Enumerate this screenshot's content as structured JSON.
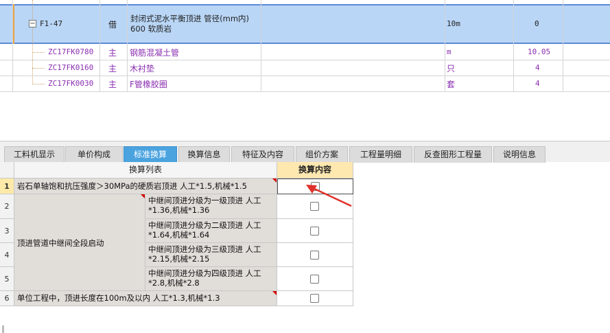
{
  "top_table": {
    "rows": [
      {
        "code": "F1-47",
        "category": "借",
        "name_line1": "封闭式泥水平衡顶进 管径(mm内)",
        "name_line2": "600 软质岩",
        "unit": "10m",
        "quantity": "0",
        "selected": true
      },
      {
        "code": "ZC17FK0780",
        "category": "主",
        "name": "钢筋混凝土管",
        "unit": "m",
        "quantity": "10.05"
      },
      {
        "code": "ZC17FK0160",
        "category": "主",
        "name": "木衬垫",
        "unit": "只",
        "quantity": "4"
      },
      {
        "code": "ZC17FK0030",
        "category": "主",
        "name": "F管橡胶圈",
        "unit": "套",
        "quantity": "4"
      }
    ]
  },
  "tabs": [
    {
      "label": "工料机显示"
    },
    {
      "label": "单价构成"
    },
    {
      "label": "标准换算",
      "active": true
    },
    {
      "label": "换算信息"
    },
    {
      "label": "特征及内容"
    },
    {
      "label": "组价方案"
    },
    {
      "label": "工程量明细"
    },
    {
      "label": "反查图形工程量"
    },
    {
      "label": "说明信息"
    }
  ],
  "conversion_grid": {
    "header_list": "换算列表",
    "header_content": "换算内容",
    "row_numbers": [
      "1",
      "2",
      "3",
      "4",
      "5",
      "6"
    ],
    "row1_text": "岩石单轴饱和抗压强度＞30MPa的硬质岩顶进 人工*1.5,机械*1.5",
    "group_label": "顶进管道中继间全段启动",
    "group_items": [
      {
        "line1": "中继间顶进分级为一级顶进 人工",
        "line2": "*1.36,机械*1.36"
      },
      {
        "line1": "中继间顶进分级为二级顶进 人工",
        "line2": "*1.64,机械*1.64"
      },
      {
        "line1": "中继间顶进分级为三级顶进 人工",
        "line2": "*2.15,机械*2.15"
      },
      {
        "line1": "中继间顶进分级为四级顶进 人工",
        "line2": "*2.8,机械*2.8"
      }
    ],
    "row6_text": "单位工程中，顶进长度在100m及以内 人工*1.3,机械*1.3"
  },
  "colors": {
    "accent": "#4aa3df",
    "selected_row": "#b9d6f6",
    "annotation_arrow": "#e0302a",
    "code_text": "#8a2fb0"
  }
}
